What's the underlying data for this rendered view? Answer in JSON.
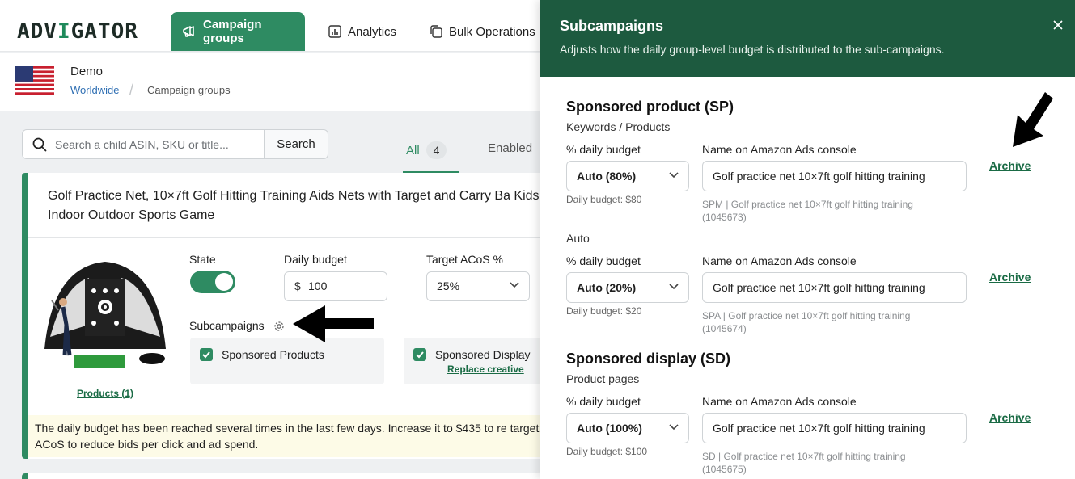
{
  "nav": {
    "logo_part1": "ADV",
    "logo_part2": "I",
    "logo_part3": "GATOR",
    "items": [
      {
        "label": "Campaign groups",
        "icon": "megaphone-icon",
        "active": true
      },
      {
        "label": "Analytics",
        "icon": "bar-chart-icon",
        "active": false
      },
      {
        "label": "Bulk Operations",
        "icon": "copy-icon",
        "active": false
      }
    ]
  },
  "header": {
    "account": "Demo",
    "breadcrumb": [
      "Worldwide",
      "Campaign groups"
    ]
  },
  "search": {
    "placeholder": "Search a child ASIN, SKU or title...",
    "button_label": "Search"
  },
  "filters": {
    "tabs": [
      {
        "label": "All",
        "count": "4",
        "active": true
      },
      {
        "label": "Enabled"
      }
    ]
  },
  "campaign": {
    "title": "Golf Practice Net, 10×7ft Golf Hitting Training Aids Nets with Target and Carry Ba Kids Indoor Outdoor Sports Game",
    "products_link": "Products (1)",
    "state_label": "State",
    "state_on": true,
    "daily_budget_label": "Daily budget",
    "daily_budget_currency": "$",
    "daily_budget_value": "100",
    "target_acos_label": "Target ACoS %",
    "target_acos_value": "25%",
    "subcampaigns_label": "Subcampaigns",
    "subcampaigns": [
      {
        "label": "Sponsored Products",
        "checked": true
      },
      {
        "label": "Sponsored Display",
        "checked": true,
        "link": "Replace creative"
      }
    ],
    "warning": "The daily budget has been reached several times in the last few days. Increase it to $435 to re target ACoS to reduce bids per click and ad spend."
  },
  "panel": {
    "title": "Subcampaigns",
    "subtitle": "Adjusts how the daily group-level budget is distributed to the sub-campaigns.",
    "percent_label": "% daily budget",
    "name_label": "Name on Amazon Ads console",
    "archive_label": "Archive",
    "sections": [
      {
        "title": "Sponsored product (SP)",
        "groups": [
          {
            "subtitle": "Keywords / Products",
            "percent": "Auto (80%)",
            "daily_budget": "Daily budget: $80",
            "name": "Golf practice net 10×7ft golf hitting training",
            "meta": "SPM | Golf practice net 10×7ft golf hitting training (1045673)"
          },
          {
            "subtitle": "Auto",
            "percent": "Auto (20%)",
            "daily_budget": "Daily budget: $20",
            "name": "Golf practice net 10×7ft golf hitting training",
            "meta": "SPA | Golf practice net 10×7ft golf hitting training (1045674)"
          }
        ]
      },
      {
        "title": "Sponsored display (SD)",
        "groups": [
          {
            "subtitle": "Product pages",
            "percent": "Auto (100%)",
            "daily_budget": "Daily budget: $100",
            "name": "Golf practice net 10×7ft golf hitting training",
            "meta": "SD | Golf practice net 10×7ft golf hitting training (1045675)"
          }
        ]
      }
    ]
  },
  "colors": {
    "brand": "#2e8b62",
    "panel_header": "#1d5a3f",
    "link": "#1a6b45"
  }
}
